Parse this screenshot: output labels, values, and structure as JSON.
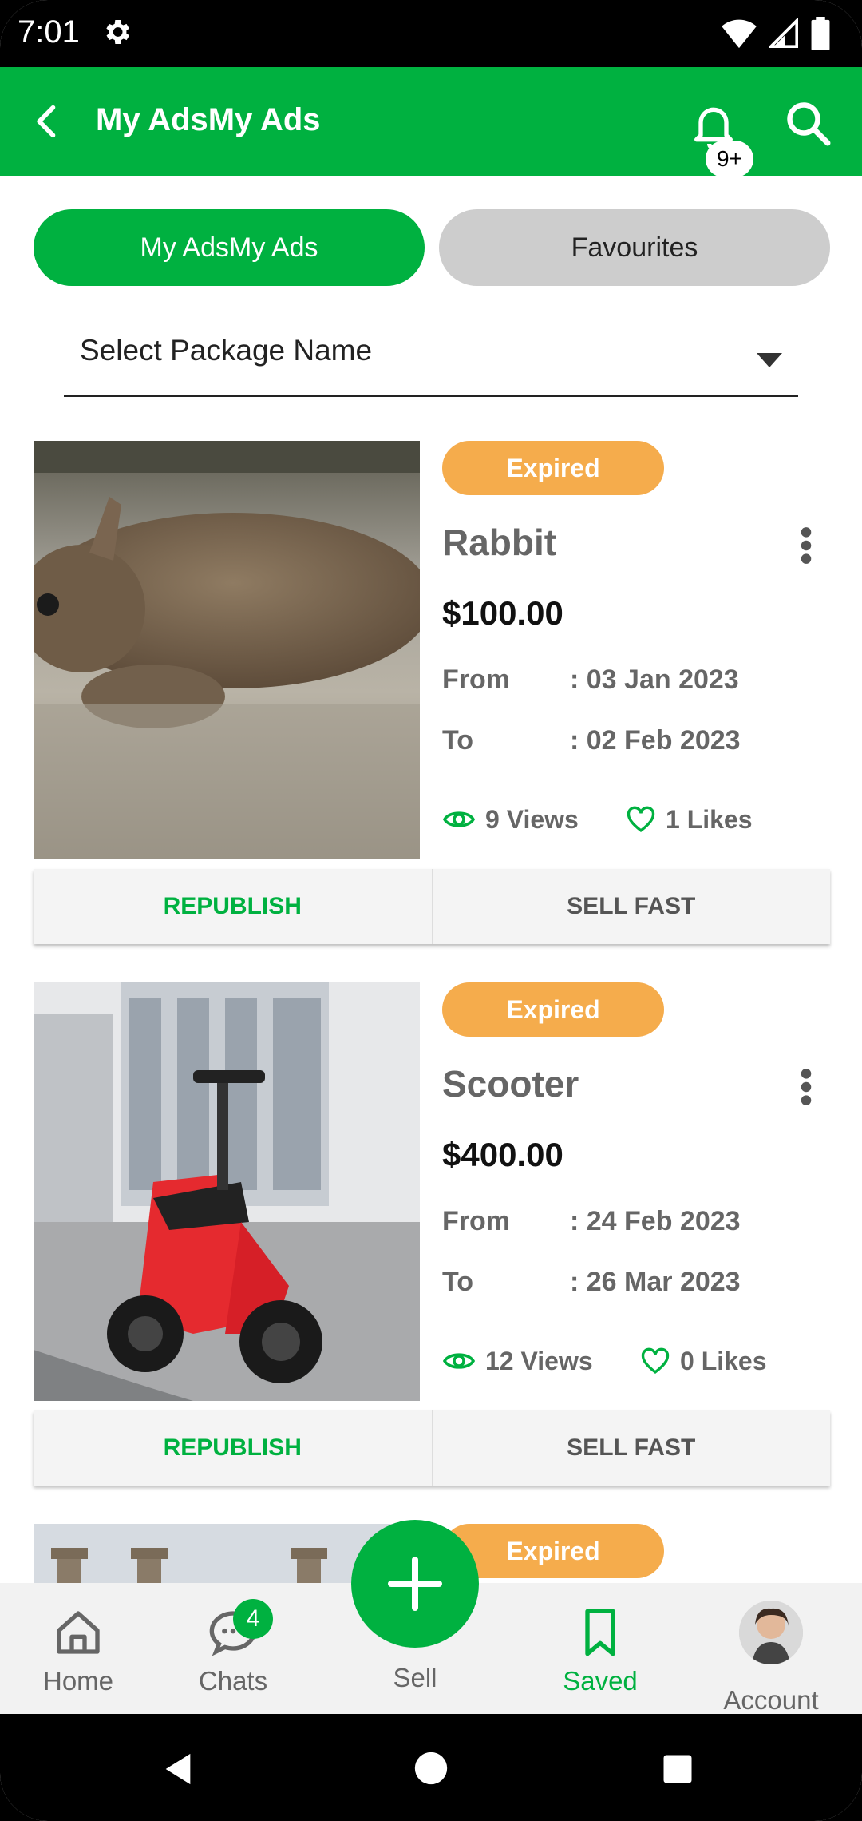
{
  "status_bar": {
    "time": "7:01"
  },
  "app_bar": {
    "title": "My AdsMy Ads",
    "notification_badge": "9+"
  },
  "tabs": [
    {
      "label": "My AdsMy Ads",
      "active": true
    },
    {
      "label": "Favourites",
      "active": false
    }
  ],
  "filter": {
    "select_text": "Select Package Name"
  },
  "ads": [
    {
      "status": "Expired",
      "name": "Rabbit",
      "price": "$100.00",
      "from_label": "From",
      "from_value": ": 03 Jan 2023",
      "to_label": "To",
      "to_value": ": 02 Feb 2023",
      "views": "9 Views",
      "likes": "1 Likes",
      "republish": "REPUBLISH",
      "sell_fast": "SELL FAST"
    },
    {
      "status": "Expired",
      "name": "Scooter",
      "price": "$400.00",
      "from_label": "From",
      "from_value": ": 24 Feb 2023",
      "to_label": "To",
      "to_value": ": 26 Mar 2023",
      "views": "12 Views",
      "likes": "0 Likes",
      "republish": "REPUBLISH",
      "sell_fast": "SELL FAST"
    },
    {
      "status": "Expired"
    }
  ],
  "bottom_nav": {
    "home": "Home",
    "chats": "Chats",
    "chats_badge": "4",
    "sell": "Sell",
    "saved": "Saved",
    "account": "Account"
  },
  "colors": {
    "primary": "#00b140",
    "expired": "#f5ac4c"
  }
}
